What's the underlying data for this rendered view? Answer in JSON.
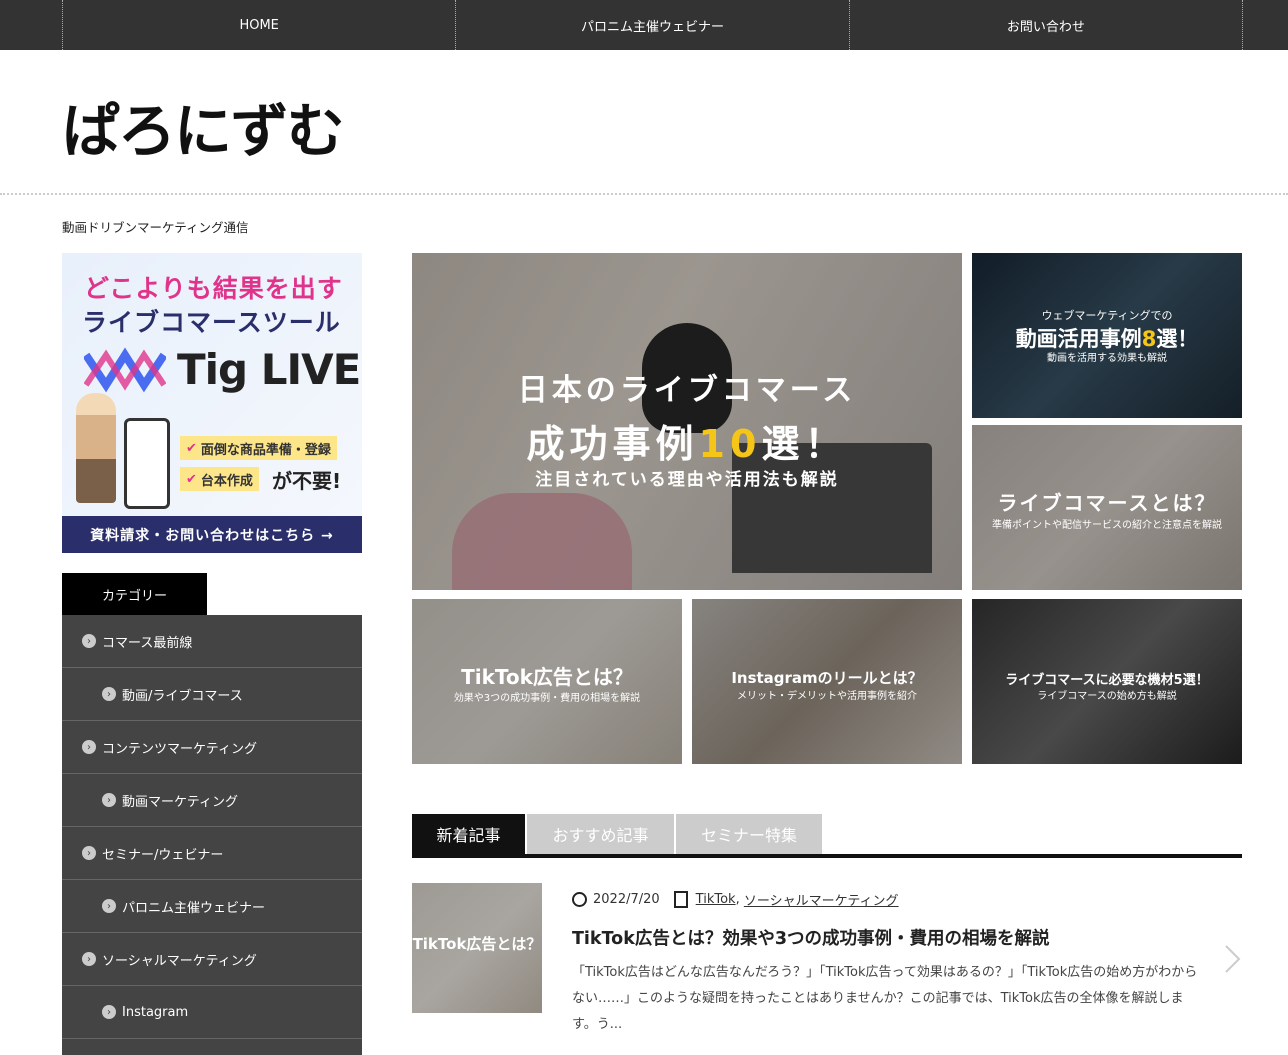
{
  "nav": {
    "items": [
      "HOME",
      "パロニム主催ウェビナー",
      "お問い合わせ"
    ]
  },
  "header": {
    "logo": "ぱろにずむ",
    "tagline": "動画ドリブンマーケティング通信"
  },
  "banner": {
    "line1": "どこよりも結果を出す",
    "line2": "ライブコマースツール",
    "brand": "Tig LIVE",
    "check1": "面倒な商品準備・登録",
    "check2": "台本作成",
    "not_needed": "が不要!",
    "cta": "資料請求・お問い合わせはこちら →"
  },
  "sidebar": {
    "category_title": "カテゴリー",
    "categories": [
      {
        "label": "コマース最前線",
        "level": 1
      },
      {
        "label": "動画/ライブコマース",
        "level": 2
      },
      {
        "label": "コンテンツマーケティング",
        "level": 1
      },
      {
        "label": "動画マーケティング",
        "level": 2
      },
      {
        "label": "セミナー/ウェビナー",
        "level": 1
      },
      {
        "label": "パロニム主催ウェビナー",
        "level": 2
      },
      {
        "label": "ソーシャルマーケティング",
        "level": 1
      },
      {
        "label": "Instagram",
        "level": 2
      }
    ]
  },
  "featured": {
    "hero": {
      "line1": "日本のライブコマース",
      "line2a": "成功事例",
      "line2b": "10",
      "line2c": "選！",
      "line3": "注目されている理由や活用法も解説"
    },
    "tile1": {
      "title_a": "動画活用事例",
      "title_b": "8",
      "title_c": "選！",
      "pre": "ウェブマーケティングでの",
      "sub": "動画を活用する効果も解説"
    },
    "tile2": {
      "title": "ライブコマースとは？",
      "sub": "準備ポイントや配信サービスの紹介と注意点を解説"
    },
    "tile3": {
      "title": "TikTok広告とは？",
      "sub": "効果や3つの成功事例・費用の相場を解説"
    },
    "tile4": {
      "title": "Instagramのリールとは？",
      "sub": "メリット・デメリットや活用事例を紹介"
    },
    "tile5": {
      "title": "ライブコマースに必要な機材5選！",
      "sub": "ライブコマースの始め方も解説"
    }
  },
  "tabs": [
    "新着記事",
    "おすすめ記事",
    "セミナー特集"
  ],
  "article": {
    "thumb_title": "TikTok広告とは？",
    "date": "2022/7/20",
    "cat1": "TikTok",
    "sep": ",",
    "cat2": "ソーシャルマーケティング",
    "title": "TikTok広告とは？効果や3つの成功事例・費用の相場を解説",
    "excerpt": "「TikTok広告はどんな広告なんだろう？」「TikTok広告って効果はあるの？」「TikTok広告の始め方がわからない……」このような疑問を持ったことはありませんか？この記事では、TikTok広告の全体像を解説します。う..."
  }
}
